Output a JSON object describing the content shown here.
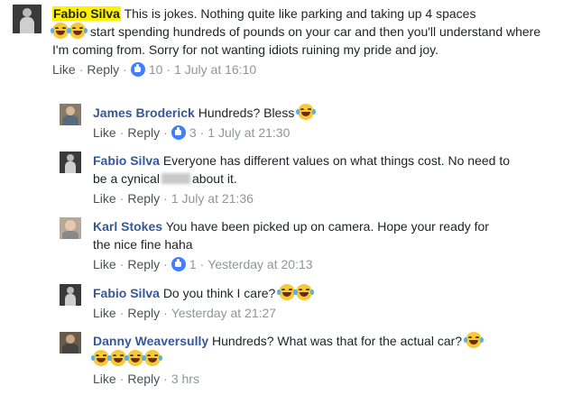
{
  "comments": [
    {
      "name": "Fabio Silva",
      "text_a": "This is jokes. Nothing quite like parking and taking up 4 spaces",
      "text_b": "start spending hundreds of pounds on your car and then you'll understand where I'm coming from. Sorry for not wanting idiots ruining my pride and joy.",
      "like": "Like",
      "reply": "Reply",
      "reactions": "10",
      "time": "1 July at 16:10"
    },
    {
      "name": "James Broderick",
      "text": "Hundreds? Bless",
      "like": "Like",
      "reply": "Reply",
      "reactions": "3",
      "time": "1 July at 21:30"
    },
    {
      "name": "Fabio Silva",
      "text_a": "Everyone has different values on what things cost. No need to be a cynical",
      "text_b": "about it.",
      "like": "Like",
      "reply": "Reply",
      "time": "1 July at 21:36"
    },
    {
      "name": "Karl Stokes",
      "text": "You have been picked up on camera. Hope your ready for the nice fine haha",
      "like": "Like",
      "reply": "Reply",
      "reactions": "1",
      "time": "Yesterday at 20:13"
    },
    {
      "name": "Fabio Silva",
      "text": "Do you think I care?",
      "like": "Like",
      "reply": "Reply",
      "time": "Yesterday at 21:27"
    },
    {
      "name": "Danny Weaversully",
      "text": "Hundreds? What was that for the actual car?",
      "like": "Like",
      "reply": "Reply",
      "time": "3 hrs"
    }
  ],
  "separator": "·",
  "colors": {
    "name_link": "#365899",
    "highlight": "#fff200",
    "meta": "#90949c",
    "like_badge": "#4080ff"
  },
  "icons": {
    "emoji": "face-with-tears-of-joy-icon",
    "like": "like-thumb-icon"
  }
}
